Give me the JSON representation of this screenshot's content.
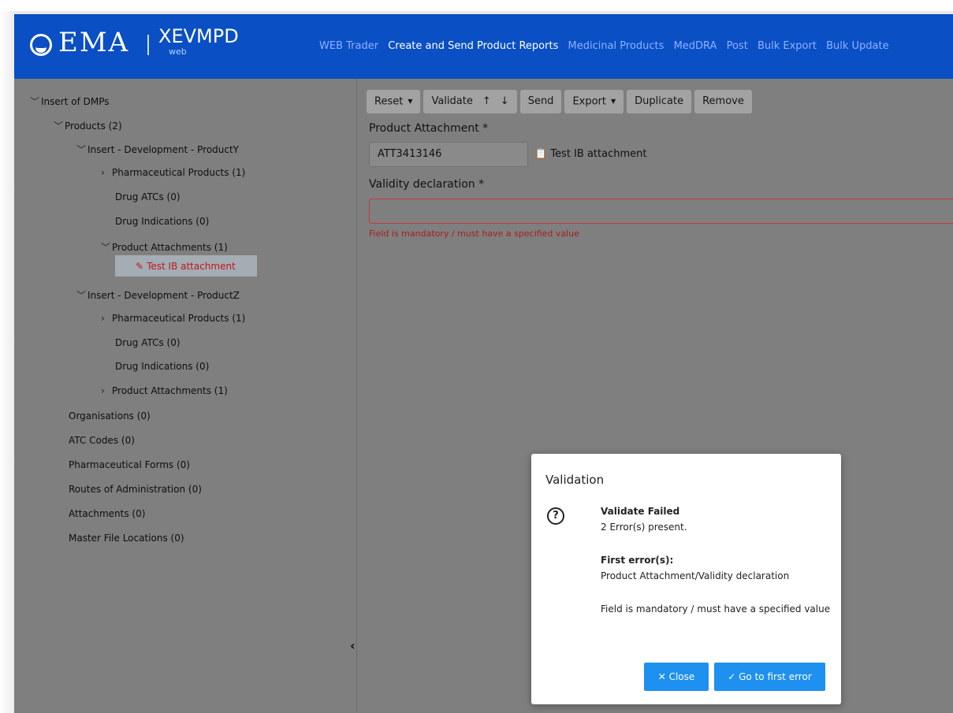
{
  "header": {
    "logo_text": "EMA",
    "product_name": "XEVMPD",
    "product_sub": "web",
    "nav": [
      "WEB Trader",
      "Create and Send Product Reports",
      "Medicinal Products",
      "MedDRA",
      "Post",
      "Bulk Export",
      "Bulk Update"
    ],
    "active_nav": "Create and Send Product Reports"
  },
  "tree": {
    "root": "Insert of DMPs",
    "products": "Products (2)",
    "product_y": "Insert - Development - ProductY",
    "y_pharma": "Pharmaceutical Products (1)",
    "y_atc": "Drug ATCs (0)",
    "y_ind": "Drug Indications (0)",
    "y_attach": "Product Attachments (1)",
    "y_attach_item": "Test IB attachment",
    "product_z": "Insert - Development - ProductZ",
    "z_pharma": "Pharmaceutical Products (1)",
    "z_atc": "Drug ATCs (0)",
    "z_ind": "Drug Indications (0)",
    "z_attach": "Product Attachments (1)",
    "organisations": "Organisations (0)",
    "atc_codes": "ATC Codes (0)",
    "pharma_forms": "Pharmaceutical Forms (0)",
    "routes": "Routes of Administration (0)",
    "attachments": "Attachments (0)",
    "master_file": "Master File Locations (0)"
  },
  "toolbar": {
    "reset": "Reset",
    "validate": "Validate",
    "up": "↑",
    "down": "↓",
    "send": "Send",
    "export": "Export",
    "duplicate": "Duplicate",
    "remove": "Remove"
  },
  "form": {
    "attachment_label": "Product Attachment *",
    "attachment_value": "ATT3413146",
    "attachment_link": "Test IB attachment",
    "validity_label": "Validity declaration *",
    "validity_value": "",
    "error_text": "Field is mandatory / must have a specified value"
  },
  "modal": {
    "title": "Validation",
    "status": "Validate Failed",
    "count": "2 Error(s) present.",
    "first_errors_heading": "First error(s):",
    "first_error_path": "Product Attachment/Validity declaration",
    "first_error_msg": "Field is mandatory / must have a specified value",
    "close_label": "Close",
    "goto_label": "Go to first error"
  },
  "colors": {
    "header_bg": "#0a4fc4",
    "error": "#c43a3a",
    "button": "#1e90f0"
  }
}
